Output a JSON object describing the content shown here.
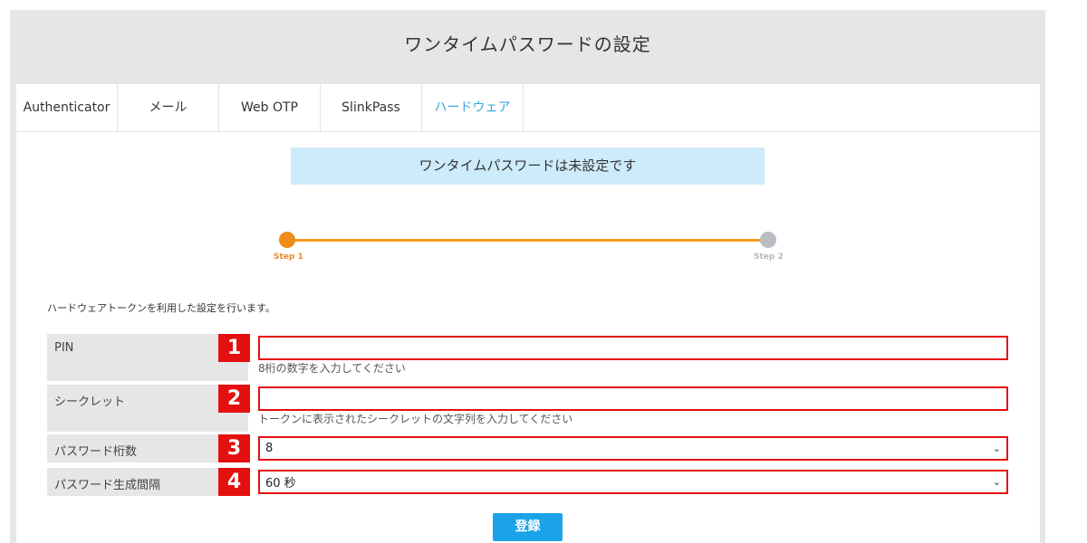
{
  "page": {
    "title": "ワンタイムパスワードの設定"
  },
  "tabs": [
    {
      "label": "Authenticator"
    },
    {
      "label": "メール"
    },
    {
      "label": "Web OTP"
    },
    {
      "label": "SlinkPass"
    },
    {
      "label": "ハードウェア",
      "active": true
    }
  ],
  "status_message": "ワンタイムパスワードは未設定です",
  "stepper": {
    "steps": [
      "Step 1",
      "Step 2"
    ],
    "current_step": 1,
    "colors": {
      "active": "#f08c1a",
      "inactive": "#b9bdc2"
    }
  },
  "intro_text": "ハードウェアトークンを利用した設定を行います。",
  "form": {
    "pin": {
      "label": "PIN",
      "badge": "1",
      "value": "",
      "hint": "8桁の数字を入力してください"
    },
    "secret": {
      "label": "シークレット",
      "badge": "2",
      "value": "",
      "hint": "トークンに表示されたシークレットの文字列を入力してください"
    },
    "digits": {
      "label": "パスワード桁数",
      "badge": "3",
      "value": "8"
    },
    "interval": {
      "label": "パスワード生成間隔",
      "badge": "4",
      "value": "60 秒"
    },
    "submit_label": "登録"
  },
  "colors": {
    "accent": "#1aa3e8",
    "highlight_border": "#e41010",
    "status_bg": "#cdebfa"
  }
}
